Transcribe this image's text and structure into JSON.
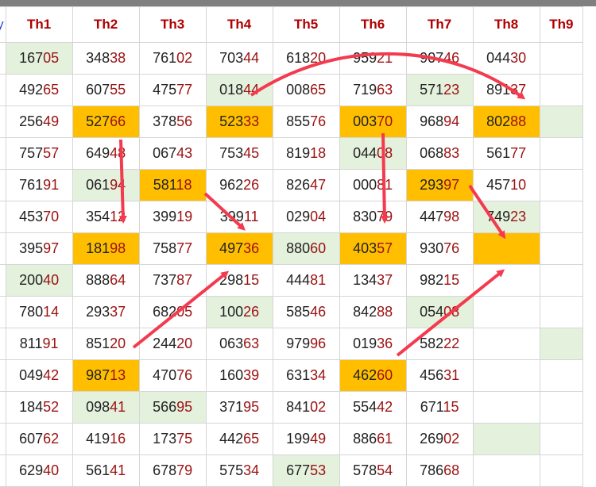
{
  "header": {
    "first_col_label": "y",
    "columns": [
      "Th1",
      "Th2",
      "Th3",
      "Th4",
      "Th5",
      "Th6",
      "Th7",
      "Th8",
      "Th9"
    ]
  },
  "rows": [
    [
      "16705",
      "34838",
      "76102",
      "70344",
      "61820",
      "95921",
      "90746",
      "04430",
      ""
    ],
    [
      "49265",
      "60755",
      "47577",
      "01844",
      "00865",
      "71963",
      "57123",
      "89137",
      ""
    ],
    [
      "25649",
      "52766",
      "37856",
      "52333",
      "85576",
      "00370",
      "96894",
      "80288",
      ""
    ],
    [
      "75757",
      "64948",
      "06743",
      "75345",
      "81918",
      "04408",
      "06883",
      "56177",
      ""
    ],
    [
      "76191",
      "06194",
      "58118",
      "96226",
      "82647",
      "00081",
      "29397",
      "45710",
      ""
    ],
    [
      "45370",
      "35412",
      "39919",
      "39911",
      "02904",
      "83079",
      "44798",
      "74923",
      ""
    ],
    [
      "39597",
      "18198",
      "75877",
      "49736",
      "88060",
      "40357",
      "93076",
      "",
      ""
    ],
    [
      "20040",
      "88864",
      "73787",
      "29815",
      "44481",
      "13437",
      "98215",
      "",
      ""
    ],
    [
      "78014",
      "29337",
      "68205",
      "10026",
      "58546",
      "84288",
      "05408",
      "",
      ""
    ],
    [
      "81191",
      "85120",
      "24420",
      "06363",
      "97996",
      "01936",
      "58222",
      "",
      ""
    ],
    [
      "04942",
      "98713",
      "47076",
      "16039",
      "63134",
      "46260",
      "45631",
      "",
      ""
    ],
    [
      "18452",
      "09841",
      "56695",
      "37195",
      "84102",
      "55442",
      "67115",
      "",
      ""
    ],
    [
      "60762",
      "41916",
      "17375",
      "44265",
      "19949",
      "88661",
      "26902",
      "",
      ""
    ],
    [
      "62940",
      "56141",
      "67879",
      "57534",
      "67753",
      "57854",
      "78668",
      "",
      ""
    ]
  ],
  "cell_highlights": {
    "green": [
      "0-0",
      "1-3",
      "1-6",
      "2-8",
      "3-5",
      "4-1",
      "5-7",
      "6-4",
      "7-0",
      "8-3",
      "8-6",
      "9-8",
      "11-1",
      "11-2",
      "12-7",
      "13-4"
    ],
    "orange": [
      "2-1",
      "2-3",
      "2-5",
      "2-7",
      "4-2",
      "4-6",
      "6-1",
      "6-3",
      "6-5",
      "6-7",
      "10-1",
      "10-5"
    ]
  },
  "colors": {
    "highlight_green": "#e4f1dd",
    "highlight_orange": "#ffbf00",
    "header_text": "#b00000",
    "last_two_digits": "#9b1111",
    "arrow": "#f43a4e"
  }
}
